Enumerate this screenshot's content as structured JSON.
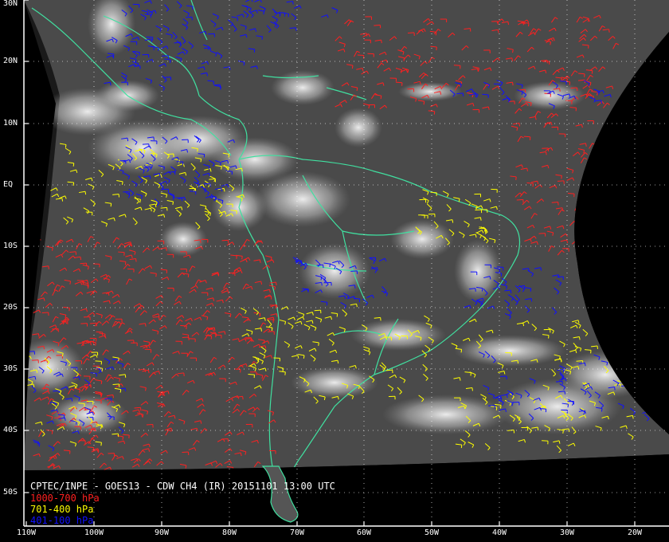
{
  "caption": "CPTEC/INPE - GOES13 - CDW CH4 (IR) 20151101 13:00 UTC",
  "legend": [
    {
      "label": "1000-700 hPa",
      "color": "#ff2020"
    },
    {
      "label": "701-400 hPa",
      "color": "#ffff00"
    },
    {
      "label": "401-100 hPa",
      "color": "#1010ff"
    }
  ],
  "lat_labels": [
    "30N",
    "20N",
    "10N",
    "EQ",
    "10S",
    "20S",
    "30S",
    "40S",
    "50S"
  ],
  "lon_labels": [
    "110W",
    "100W",
    "90W",
    "80W",
    "70W",
    "60W",
    "50W",
    "40W",
    "30W",
    "20W"
  ],
  "colors": {
    "background": "#000000",
    "coast": "#40e0a0",
    "grid": "#ffffff"
  }
}
